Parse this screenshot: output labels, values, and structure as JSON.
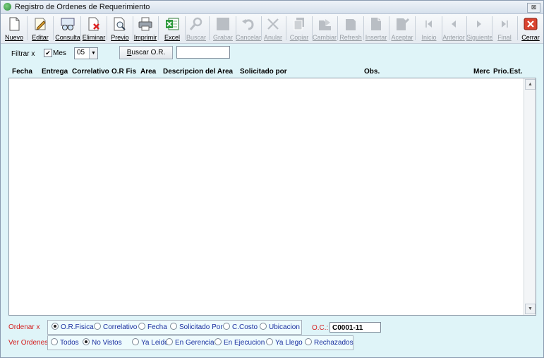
{
  "window": {
    "title": "Registro de Ordenes de Requerimiento",
    "close_symbol": "⊠"
  },
  "toolbar": {
    "buttons": [
      {
        "id": "nuevo",
        "label": "Nuevo",
        "enabled": true,
        "icon": "document-icon"
      },
      {
        "id": "editar",
        "label": "Editar",
        "enabled": true,
        "icon": "pencil-icon"
      },
      {
        "id": "consulta",
        "label": "Consulta",
        "enabled": true,
        "icon": "glasses-icon"
      },
      {
        "id": "eliminar",
        "label": "Eliminar",
        "enabled": true,
        "icon": "delete-document-icon"
      },
      {
        "id": "previo",
        "label": "Previo",
        "enabled": true,
        "icon": "magnifier-document-icon"
      },
      {
        "id": "imprimir",
        "label": "Imprimir",
        "enabled": true,
        "icon": "printer-icon"
      },
      {
        "id": "excel",
        "label": "Excel",
        "enabled": true,
        "icon": "excel-icon"
      },
      {
        "id": "buscar",
        "label": "Buscar",
        "enabled": false,
        "icon": "search-icon"
      },
      {
        "id": "grabar",
        "label": "Grabar",
        "enabled": false,
        "icon": "save-icon"
      },
      {
        "id": "cancelar",
        "label": "Cancelar",
        "enabled": false,
        "icon": "undo-icon"
      },
      {
        "id": "anular",
        "label": "Anular",
        "enabled": false,
        "icon": "x-icon"
      },
      {
        "id": "copiar",
        "label": "Copiar",
        "enabled": false,
        "icon": "copy-icon"
      },
      {
        "id": "cambiar",
        "label": "Cambiar",
        "enabled": false,
        "icon": "change-icon"
      },
      {
        "id": "refresh",
        "label": "Refresh",
        "enabled": false,
        "icon": "refresh-icon"
      },
      {
        "id": "insertar",
        "label": "Insertar",
        "enabled": false,
        "icon": "insert-icon"
      },
      {
        "id": "aceptar",
        "label": "Aceptar",
        "enabled": false,
        "icon": "accept-icon"
      },
      {
        "id": "inicio",
        "label": "Inicio",
        "enabled": false,
        "icon": "first-icon"
      },
      {
        "id": "anterior",
        "label": "Anterior",
        "enabled": false,
        "icon": "prev-icon"
      },
      {
        "id": "siguiente",
        "label": "Siguiente",
        "enabled": false,
        "icon": "next-icon"
      },
      {
        "id": "final",
        "label": "Final",
        "enabled": false,
        "icon": "last-icon"
      },
      {
        "id": "cerrar",
        "label": "Cerrar",
        "enabled": true,
        "icon": "close-icon"
      }
    ]
  },
  "filter": {
    "label": "Filtrar x",
    "mes_label": "Mes",
    "mes_checked_symbol": "✔",
    "mes_value": "05",
    "dropdown_arrow": "▼",
    "buscar_label_u": "B",
    "buscar_label_rest": "uscar O.R.",
    "search_value": ""
  },
  "table": {
    "columns": [
      "Fecha",
      "Entrega",
      "Correlativo",
      "O.R Fis",
      "Area",
      "Descripcion del Area",
      "Solicitado por",
      "Obs.",
      "Merc",
      "Prio.",
      "Est."
    ],
    "rows": [],
    "scroll_up_symbol": "▲",
    "scroll_down_symbol": "▼"
  },
  "ordenar": {
    "label": "Ordenar x",
    "options": [
      "O.R.Fisica",
      "Correlativo",
      "Fecha",
      "Solicitado Por",
      "C.Costo",
      "Ubicacion"
    ],
    "selected": 0
  },
  "oc": {
    "label": "O.C.:",
    "value": "C0001-11"
  },
  "ver_ordenes": {
    "label": "Ver Ordenes",
    "options": [
      "Todos",
      "No Vistos",
      "Ya Leidos",
      "En Gerencia",
      "En Ejecucion",
      "Ya Llego",
      "Rechazados"
    ],
    "selected": 1
  },
  "colors": {
    "background": "#dff4f8",
    "red_label": "#d42020",
    "radio_text": "#1a2fa0",
    "excel_green": "#2e9a3c",
    "close_red": "#d9432f"
  }
}
